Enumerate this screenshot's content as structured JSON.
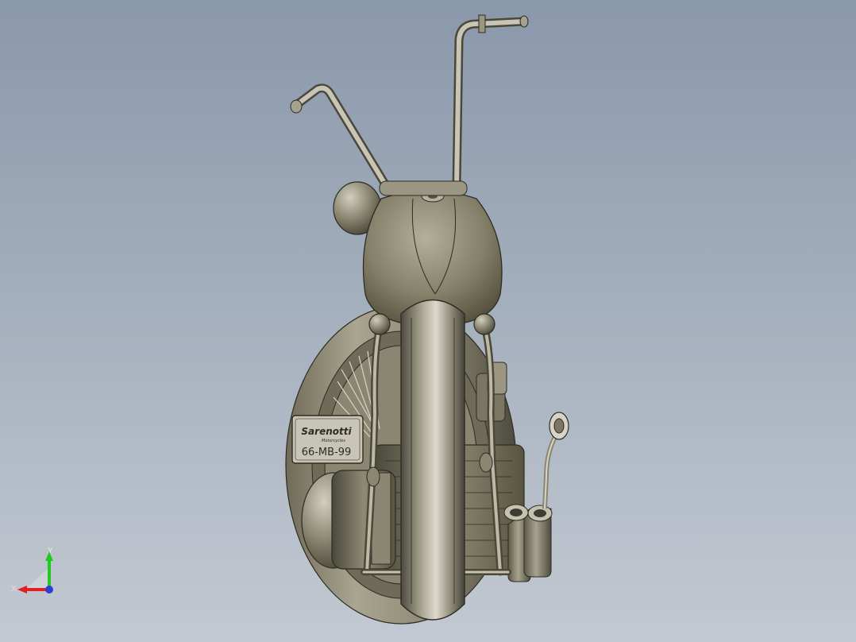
{
  "window": {
    "title": ""
  },
  "model": {
    "plate_brand": "Sarenotti",
    "plate_subtitle": "Motorcycles",
    "plate_number": "66-MB-99"
  },
  "triad": {
    "x_label": "X",
    "y_label": "Y"
  },
  "colors": {
    "bg_top": "#8a98ab",
    "bg_bottom": "#c3c9d2",
    "body": "#86816c",
    "highlight": "#dedbcd",
    "shadow": "#3e3c33",
    "axis_x": "#e32020",
    "axis_y": "#23c823",
    "axis_z": "#2b3fd8"
  }
}
